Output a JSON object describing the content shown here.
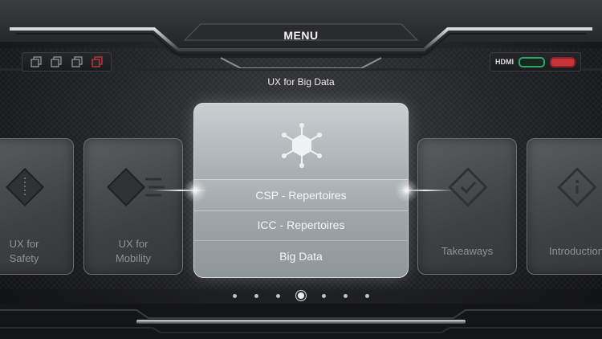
{
  "header": {
    "title": "MENU",
    "subtitle": "UX for Big Data"
  },
  "status": {
    "hdmi_label": "HDMI",
    "port_colors": [
      "#2ea36a",
      "#c5343a"
    ]
  },
  "carousel": {
    "left_cards": [
      {
        "label_line1": "UX for",
        "label_line2": "Safety",
        "icon": "diamond-icon"
      },
      {
        "label_line1": "UX for",
        "label_line2": "Mobility",
        "icon": "diamond-lines-icon"
      }
    ],
    "center_card": {
      "icon": "hexagon-network-icon",
      "items": [
        "CSP - Repertoires",
        "ICC - Repertoires",
        "Big Data"
      ]
    },
    "right_cards": [
      {
        "label": "Takeaways",
        "icon": "diamond-check-icon"
      },
      {
        "label": "Introduction",
        "icon": "diamond-info-icon"
      }
    ]
  },
  "pagination": {
    "total": 7,
    "active_index": 3
  },
  "colors": {
    "accent_red": "#c5343a",
    "accent_green": "#2ea36a"
  }
}
